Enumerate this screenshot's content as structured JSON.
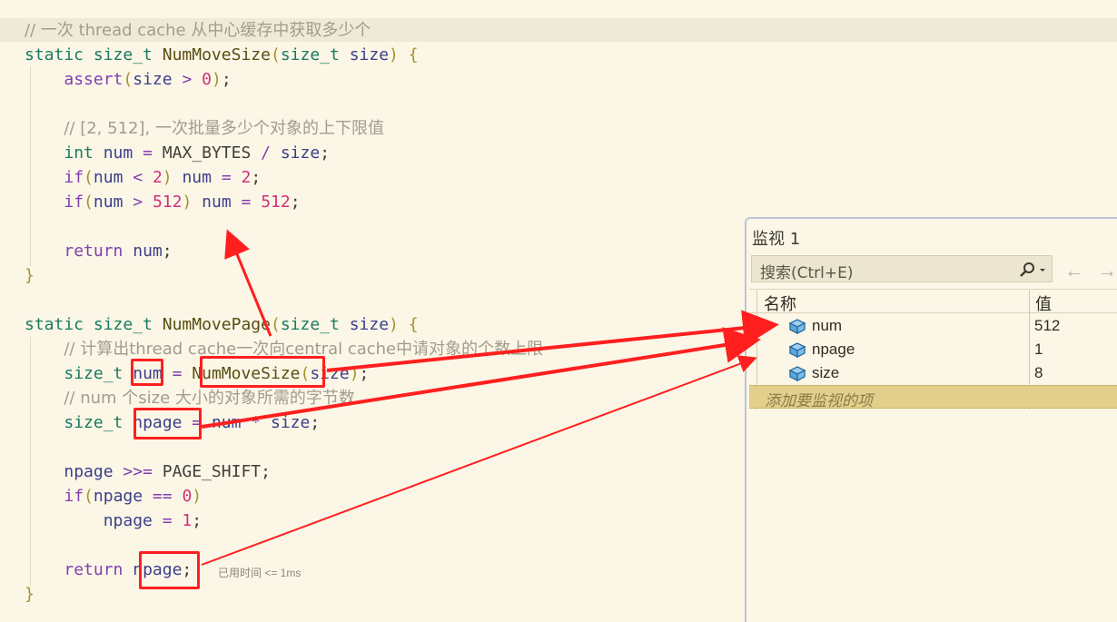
{
  "editor": {
    "lines": [
      [
        "// 一次 thread cache 从中心缓存中获取多少个"
      ],
      [
        "static",
        "size_t",
        "NumMoveSize",
        "size_t",
        "size"
      ],
      [
        "assert",
        "size",
        "0"
      ],
      [],
      [
        "// [2, 512], 一次批量多少个对象的上下限值"
      ],
      [
        "int",
        "num",
        "MAX_BYTES",
        "size"
      ],
      [
        "if",
        "num",
        "2",
        "num",
        "2"
      ],
      [
        "if",
        "num",
        "512",
        "num",
        "512"
      ],
      [],
      [
        "return",
        "num"
      ],
      [],
      [],
      [
        "static",
        "size_t",
        "NumMovePage",
        "size_t",
        "size"
      ],
      [
        "// 计算出thread cache一次向central cache中请对象的个数上限"
      ],
      [
        "size_t",
        "num",
        "NumMoveSize",
        "size"
      ],
      [
        "// num 个size 大小的对象所需的字节数"
      ],
      [
        "size_t",
        "npage",
        "num",
        "size"
      ],
      [],
      [
        "npage",
        "PAGE_SHIFT"
      ],
      [
        "if",
        "npage",
        "0"
      ],
      [
        "npage",
        "1"
      ],
      [],
      [
        "return",
        "npage"
      ]
    ],
    "elapsed_hint": "已用时间 <= 1ms"
  },
  "watch": {
    "title": "监视 1",
    "search_placeholder": "搜索(Ctrl+E)",
    "col_name": "名称",
    "col_value": "值",
    "rows": [
      {
        "name": "num",
        "value": "512"
      },
      {
        "name": "npage",
        "value": "1"
      },
      {
        "name": "size",
        "value": "8"
      }
    ],
    "add_item": "添加要监视的项",
    "back_arrow": "←",
    "forward_arrow": "→"
  },
  "colors": {
    "highlight_red": "#ff1f1f",
    "editor_bg": "#fbf6e6"
  }
}
